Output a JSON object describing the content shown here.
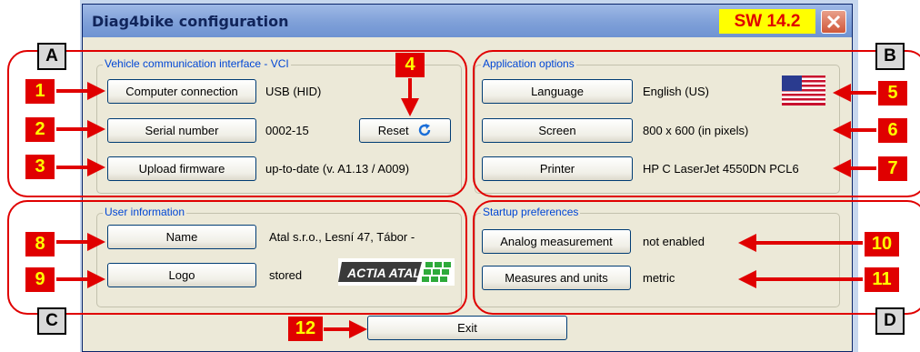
{
  "window": {
    "title": "Diag4bike configuration",
    "version_badge": "SW 14.2"
  },
  "colors": {
    "annotation_red": "#e00000",
    "annotation_yellow": "#ffff00",
    "group_title": "#0046d5",
    "window_bg": "#ece9d8"
  },
  "groups": {
    "vci": {
      "title": "Vehicle communication interface - VCI",
      "computer_connection": {
        "label": "Computer connection",
        "value": "USB (HID)"
      },
      "serial_number": {
        "label": "Serial number",
        "value": "0002-15"
      },
      "reset": {
        "label": "Reset",
        "icon": "refresh-icon"
      },
      "upload_firmware": {
        "label": "Upload firmware",
        "value": "up-to-date (v. A1.13 / A009)"
      }
    },
    "app": {
      "title": "Application options",
      "language": {
        "label": "Language",
        "value": "English (US)",
        "icon": "us-flag-icon"
      },
      "screen": {
        "label": "Screen",
        "value": "800 x 600 (in pixels)"
      },
      "printer": {
        "label": "Printer",
        "value": "HP C LaserJet 4550DN PCL6"
      }
    },
    "user": {
      "title": "User information",
      "name": {
        "label": "Name",
        "value": "Atal s.r.o., Lesní 47, Tábor -"
      },
      "logo": {
        "label": "Logo",
        "value": "stored",
        "logo_text": "ACTIA ATAL"
      }
    },
    "startup": {
      "title": "Startup preferences",
      "analog": {
        "label": "Analog measurement",
        "value": "not enabled"
      },
      "measures": {
        "label": "Measures and units",
        "value": "metric"
      }
    }
  },
  "exit_label": "Exit",
  "annotations": {
    "sections": [
      "A",
      "B",
      "C",
      "D"
    ],
    "numbers": [
      "1",
      "2",
      "3",
      "4",
      "5",
      "6",
      "7",
      "8",
      "9",
      "10",
      "11",
      "12"
    ]
  }
}
